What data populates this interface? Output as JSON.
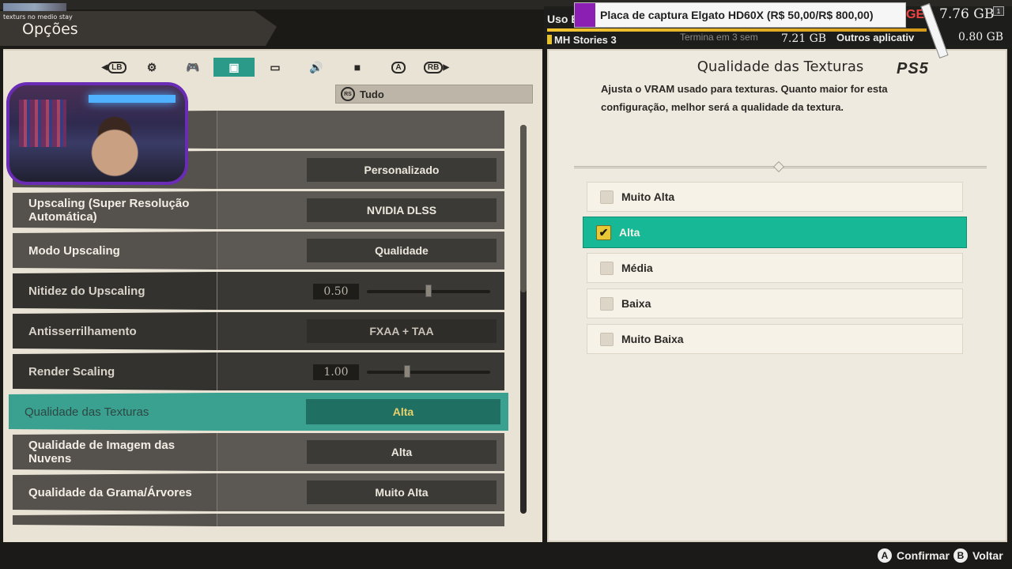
{
  "window": {
    "title": "Opções",
    "stream_note": "texturs no medio stay"
  },
  "tabs": [
    {
      "name": "tab-lb",
      "label": "LB",
      "icon": "bumper-left-icon"
    },
    {
      "name": "tab-general",
      "label": "⚙",
      "icon": "gear-icon"
    },
    {
      "name": "tab-controller",
      "label": "🎮",
      "icon": "controller-icon"
    },
    {
      "name": "tab-graphics",
      "label": "▣",
      "icon": "image-icon",
      "active": true
    },
    {
      "name": "tab-display",
      "label": "▭",
      "icon": "monitor-icon"
    },
    {
      "name": "tab-audio",
      "label": "🔊",
      "icon": "speaker-icon"
    },
    {
      "name": "tab-camera",
      "label": "■",
      "icon": "camera-icon"
    },
    {
      "name": "tab-text",
      "label": "A",
      "icon": "text-icon"
    },
    {
      "name": "tab-rb",
      "label": "RB",
      "icon": "bumper-right-icon"
    }
  ],
  "filter": {
    "button": "RS",
    "label": "Tudo"
  },
  "settings": [
    {
      "label": "",
      "value": ""
    },
    {
      "label": "",
      "value": "Personalizado"
    },
    {
      "label": "Upscaling (Super Resolução Automática)",
      "value": "NVIDIA DLSS"
    },
    {
      "label": "Modo Upscaling",
      "value": "Qualidade"
    },
    {
      "label": "Nitidez do Upscaling",
      "value": "0.50",
      "slider": 0.5
    },
    {
      "label": "Antisserrilhamento",
      "value": "FXAA + TAA"
    },
    {
      "label": "Render Scaling",
      "value": "1.00",
      "slider": 0.33
    },
    {
      "label": "Qualidade das Texturas",
      "value": "Alta",
      "selected": true
    },
    {
      "label": "Qualidade de Imagem das Nuvens",
      "value": "Alta"
    },
    {
      "label": "Qualidade da Grama/Árvores",
      "value": "Muito Alta"
    }
  ],
  "detail": {
    "title": "Qualidade das Texturas",
    "description": "Ajusta o VRAM usado para texturas. Quanto maior for esta configuração, melhor será a qualidade da textura.",
    "platform_logo": "PS5",
    "options": [
      {
        "label": "Muito Alta",
        "checked": false
      },
      {
        "label": "Alta",
        "checked": true
      },
      {
        "label": "Média",
        "checked": false
      },
      {
        "label": "Baixa",
        "checked": false
      },
      {
        "label": "Muito Baixa",
        "checked": false
      }
    ]
  },
  "overlay": {
    "uso": "Uso E",
    "capture": "Placa de captura Elgato HD60X (R$ 50,00/R$ 800,00)",
    "ge": "GE",
    "gb_total": "7.76 GB",
    "app": "MH Stories 3",
    "termina": "Termina em 3 sem",
    "gb_app": "7.21 GB",
    "outros": "Outros aplicativ",
    "gb_outros": "0.80 GB",
    "badge": "1"
  },
  "hints": [
    {
      "button": "A",
      "label": "Confirmar"
    },
    {
      "button": "B",
      "label": "Voltar"
    }
  ],
  "colors": {
    "accent": "#17b896",
    "selected_row": "#3aa190",
    "panel": "#efeadf"
  }
}
